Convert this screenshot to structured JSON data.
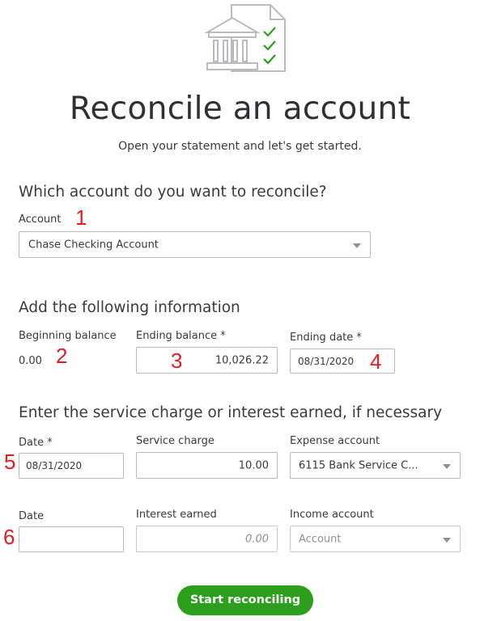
{
  "header": {
    "icon": "bank-statement-checklist-icon",
    "title": "Reconcile an account",
    "subtitle": "Open your statement and let's get started."
  },
  "account_section": {
    "heading": "Which account do you want to reconcile?",
    "account_label": "Account",
    "account_value": "Chase Checking Account"
  },
  "info_section": {
    "heading": "Add the following information",
    "beginning_balance_label": "Beginning balance",
    "beginning_balance_value": "0.00",
    "ending_balance_label": "Ending balance *",
    "ending_balance_value": "10,026.22",
    "ending_date_label": "Ending date *",
    "ending_date_value": "08/31/2020"
  },
  "charges_section": {
    "heading": "Enter the service charge or interest earned, if necessary",
    "service_date_label": "Date *",
    "service_date_value": "08/31/2020",
    "service_charge_label": "Service charge",
    "service_charge_value": "10.00",
    "expense_account_label": "Expense account",
    "expense_account_value": "6115 Bank Service C...",
    "interest_date_label": "Date",
    "interest_date_value": "",
    "interest_earned_label": "Interest earned",
    "interest_earned_placeholder": "0.00",
    "income_account_label": "Income account",
    "income_account_placeholder": "Account"
  },
  "annotations": [
    "1",
    "2",
    "3",
    "4",
    "5",
    "6"
  ],
  "footer": {
    "start_button_label": "Start reconciling"
  },
  "colors": {
    "primary_button": "#2ca01c",
    "annotation_red": "#e31c23",
    "check_green": "#2ca01c"
  }
}
